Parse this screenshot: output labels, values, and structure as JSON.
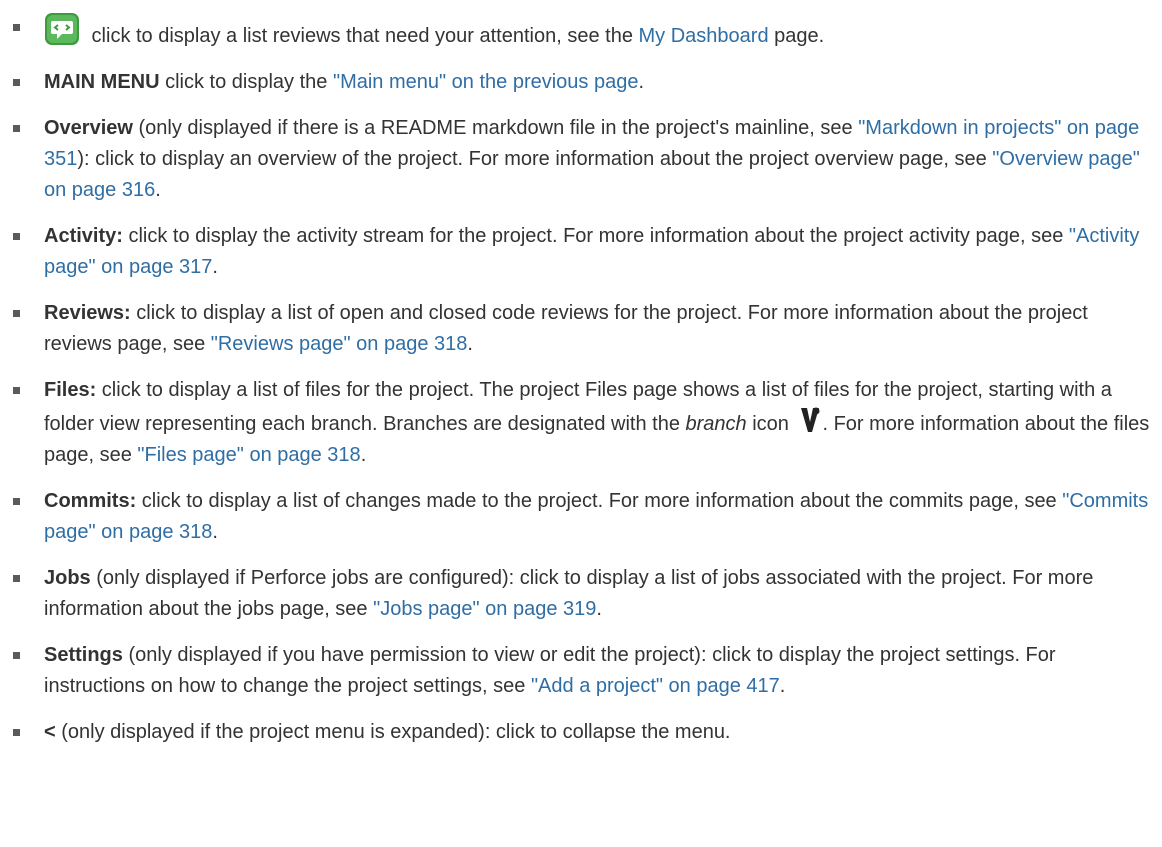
{
  "items": [
    {
      "pre": "",
      "post": " click to display a list reviews that need your attention, see the ",
      "link": "My Dashboard",
      "tail": " page."
    },
    {
      "term": "MAIN MENU",
      "text": " click to display the ",
      "link": "\"Main menu\" on the previous page",
      "tail": "."
    },
    {
      "term": "Overview",
      "text": " (only displayed if there is a README markdown file in the project's mainline, see ",
      "link": "\"Markdown in projects\" on page 351",
      "text2": "): click to display an overview of the project. For more information about the project overview page, see ",
      "link2": "\"Overview page\" on page 316",
      "tail": "."
    },
    {
      "term": "Activity:",
      "text": " click to display the activity stream for the project. For more information about the project activity page, see ",
      "link": "\"Activity page\" on page 317",
      "tail": "."
    },
    {
      "term": "Reviews:",
      "text": " click to display a list of open and closed code reviews for the project. For more information about the project reviews page, see ",
      "link": "\"Reviews page\" on page 318",
      "tail": "."
    },
    {
      "term": "Files:",
      "text": " click to display a list of files for the project. The project Files page shows a list of files for the project, starting with a folder view representing each branch. Branches are designated with the ",
      "em": "branch",
      "text2": " icon ",
      "text3": ". For more information about the files page, see ",
      "link": "\"Files page\" on page 318",
      "tail": "."
    },
    {
      "term": "Commits:",
      "text": " click to display a list of changes made to the project. For more information about the commits page, see ",
      "link": "\"Commits page\" on page 318",
      "tail": "."
    },
    {
      "term": "Jobs",
      "text": " (only displayed if Perforce jobs are configured): click to display a list of jobs associated with the project. For more information about the jobs page, see ",
      "link": "\"Jobs page\" on page 319",
      "tail": "."
    },
    {
      "term": "Settings",
      "text": " (only displayed if you have permission to view or edit the project): click to display the project settings. For instructions on how to change the project settings, see ",
      "link": "\"Add a project\" on page 417",
      "tail": "."
    },
    {
      "term": "<",
      "text": " (only displayed if the project menu is expanded): click to collapse the menu."
    }
  ],
  "icons": {
    "dashboard": "dashboard-icon",
    "branch": "branch-icon",
    "accent": "#5cb85c"
  }
}
